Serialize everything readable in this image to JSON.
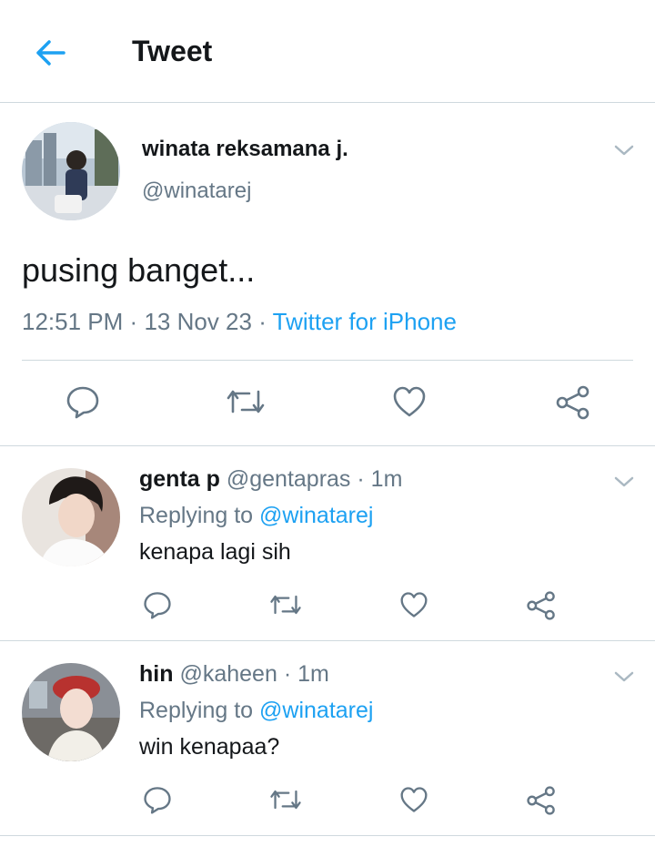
{
  "header": {
    "title": "Tweet"
  },
  "tweet": {
    "author_name": "winata reksamana j.",
    "author_handle": "@winatarej",
    "text": "pusing banget...",
    "time": "12:51 PM",
    "separator": "·",
    "date": "13 Nov 23",
    "source": "Twitter for iPhone"
  },
  "replies": [
    {
      "name": "genta p",
      "handle": "@gentapras",
      "dot": "·",
      "time": "1m",
      "replying_prefix": "Replying to",
      "replying_to": "@winatarej",
      "text": "kenapa lagi sih"
    },
    {
      "name": "hin",
      "handle": "@kaheen",
      "dot": "·",
      "time": "1m",
      "replying_prefix": "Replying to",
      "replying_to": "@winatarej",
      "text": "win kenapaa?"
    }
  ],
  "icons": {
    "back": "arrow-left-icon",
    "reply": "speech-bubble-icon",
    "retweet": "retweet-icon",
    "like": "heart-icon",
    "share": "share-icon",
    "more": "chevron-down-icon"
  },
  "colors": {
    "accent": "#1da1f2",
    "secondary_text": "#657786",
    "icon_gray": "#657786",
    "divider": "#cfd9de"
  }
}
